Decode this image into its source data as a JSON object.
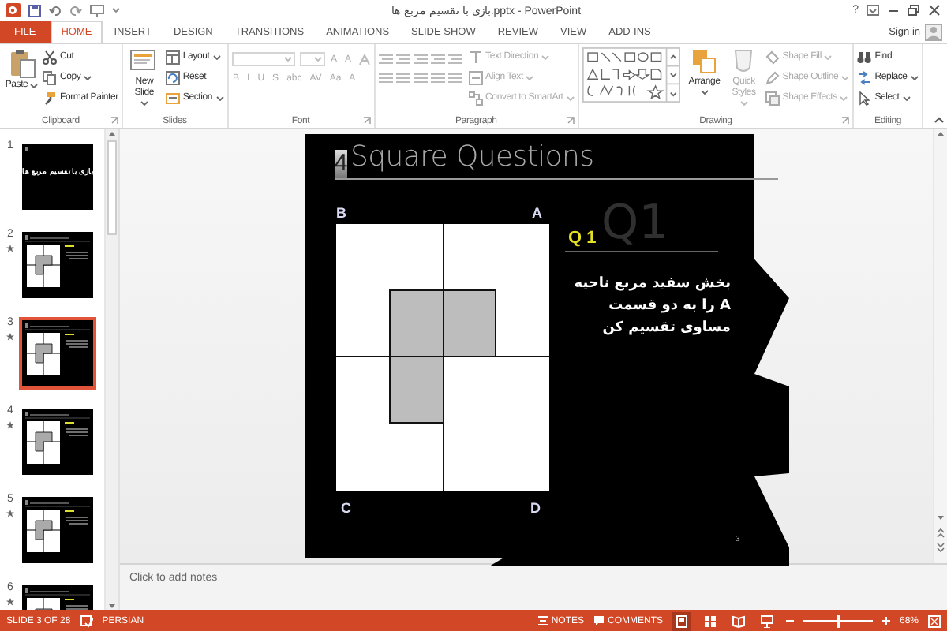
{
  "window": {
    "title": "بازی با تقسیم مربع ها.pptx - PowerPoint",
    "help": "?",
    "sign_in": "Sign in"
  },
  "tabs": [
    {
      "label": "FILE",
      "kind": "file",
      "selected": false
    },
    {
      "label": "HOME",
      "kind": "tab",
      "selected": true
    },
    {
      "label": "INSERT",
      "kind": "tab",
      "selected": false
    },
    {
      "label": "DESIGN",
      "kind": "tab",
      "selected": false
    },
    {
      "label": "TRANSITIONS",
      "kind": "tab",
      "selected": false
    },
    {
      "label": "ANIMATIONS",
      "kind": "tab",
      "selected": false
    },
    {
      "label": "SLIDE SHOW",
      "kind": "tab",
      "selected": false
    },
    {
      "label": "REVIEW",
      "kind": "tab",
      "selected": false
    },
    {
      "label": "VIEW",
      "kind": "tab",
      "selected": false
    },
    {
      "label": "ADD-INS",
      "kind": "tab",
      "selected": false
    }
  ],
  "ribbon": {
    "groups": [
      {
        "label": "Clipboard",
        "launcher": true,
        "items": [
          {
            "kind": "large",
            "label": "Paste",
            "menu": true,
            "disabled": false
          },
          {
            "kind": "small",
            "label": "Cut",
            "disabled": false
          },
          {
            "kind": "small",
            "label": "Copy",
            "menu": true,
            "disabled": false
          },
          {
            "kind": "small",
            "label": "Format Painter",
            "disabled": false
          }
        ]
      },
      {
        "label": "Slides",
        "launcher": false,
        "items": [
          {
            "kind": "large",
            "label": "New Slide",
            "menu": true,
            "disabled": false
          },
          {
            "kind": "small",
            "label": "Layout",
            "menu": true,
            "disabled": false
          },
          {
            "kind": "small",
            "label": "Reset",
            "disabled": false
          },
          {
            "kind": "small",
            "label": "Section",
            "menu": true,
            "disabled": false
          }
        ]
      },
      {
        "label": "Font",
        "launcher": true,
        "items": [
          {
            "kind": "combo",
            "disabled": true
          },
          {
            "kind": "combo",
            "disabled": true
          },
          {
            "kind": "glyph",
            "label": "A",
            "disabled": true
          },
          {
            "kind": "glyph",
            "label": "A",
            "disabled": true
          },
          {
            "kind": "glyph",
            "label": "B",
            "disabled": true
          },
          {
            "kind": "glyph",
            "label": "I",
            "disabled": true
          },
          {
            "kind": "glyph",
            "label": "U",
            "disabled": true
          },
          {
            "kind": "glyph",
            "label": "S",
            "disabled": true
          },
          {
            "kind": "glyph",
            "label": "abc",
            "disabled": true
          },
          {
            "kind": "glyph",
            "label": "AV",
            "disabled": true
          },
          {
            "kind": "glyph",
            "label": "Aa",
            "disabled": true
          },
          {
            "kind": "glyph",
            "label": "A",
            "disabled": true
          }
        ]
      },
      {
        "label": "Paragraph",
        "launcher": true,
        "items": [
          {
            "kind": "small",
            "label": "Text Direction",
            "menu": true,
            "disabled": true
          },
          {
            "kind": "small",
            "label": "Align Text",
            "menu": true,
            "disabled": true
          },
          {
            "kind": "small",
            "label": "Convert to SmartArt",
            "menu": true,
            "disabled": true
          }
        ]
      },
      {
        "label": "Drawing",
        "launcher": true,
        "items": [
          {
            "kind": "gallery",
            "disabled": false
          },
          {
            "kind": "large",
            "label": "Arrange",
            "menu": true,
            "disabled": false
          },
          {
            "kind": "large",
            "label": "Quick Styles",
            "menu": true,
            "disabled": true
          },
          {
            "kind": "small",
            "label": "Shape Fill",
            "menu": true,
            "disabled": true
          },
          {
            "kind": "small",
            "label": "Shape Outline",
            "menu": true,
            "disabled": true
          },
          {
            "kind": "small",
            "label": "Shape Effects",
            "menu": true,
            "disabled": true
          }
        ]
      },
      {
        "label": "Editing",
        "launcher": false,
        "items": [
          {
            "kind": "small",
            "label": "Find",
            "disabled": false
          },
          {
            "kind": "small",
            "label": "Replace",
            "menu": true,
            "disabled": false
          },
          {
            "kind": "small",
            "label": "Select",
            "menu": true,
            "disabled": false
          }
        ]
      }
    ]
  },
  "slides": [
    {
      "number": "1",
      "kind": "title",
      "title": "بازی با تقسیم مربع ها",
      "starred": false,
      "selected": false
    },
    {
      "number": "2",
      "kind": "question",
      "starred": true,
      "selected": false
    },
    {
      "number": "3",
      "kind": "question",
      "starred": true,
      "selected": true
    },
    {
      "number": "4",
      "kind": "question",
      "starred": true,
      "selected": false
    },
    {
      "number": "5",
      "kind": "question",
      "starred": true,
      "selected": false
    },
    {
      "number": "6",
      "kind": "question",
      "starred": true,
      "selected": false
    }
  ],
  "slide": {
    "number_badge": "4",
    "title": "Square Questions",
    "corner_labels": [
      "B",
      "A",
      "C",
      "D"
    ],
    "ghost_label": "Q1",
    "question_label": "Q 1",
    "question": "بخش سفید مربع ناحیه **A** را به دو قسمت مساوی تقسیم کن",
    "page_number": "3"
  },
  "notes": {
    "placeholder": "Click to add notes"
  },
  "status_bar": {
    "slide_indicator": "SLIDE 3 OF 28",
    "language": "PERSIAN",
    "notes": "NOTES",
    "comments": "COMMENTS",
    "views": [
      {
        "selected": true
      },
      {
        "selected": false
      },
      {
        "selected": false
      },
      {
        "selected": false
      }
    ],
    "zoom_slider": {
      "level": 0.5
    },
    "zoom": "68%"
  }
}
